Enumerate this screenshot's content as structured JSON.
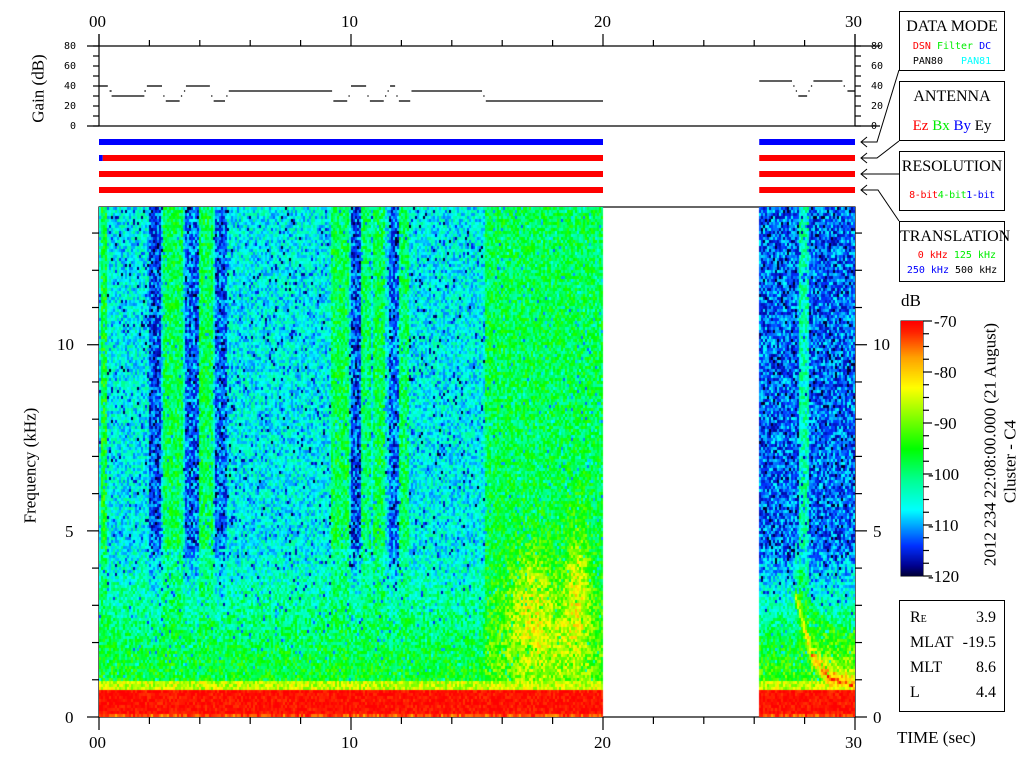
{
  "gain_panel": {
    "ylabel": "Gain (dB)",
    "yticks": [
      "0",
      "20",
      "40",
      "60",
      "80"
    ],
    "ylim": [
      0,
      80
    ]
  },
  "time_axis": {
    "ticks": [
      "00",
      "10",
      "20",
      "30"
    ],
    "xlim": [
      0,
      30
    ],
    "label": "TIME (sec)"
  },
  "spectrogram": {
    "ylabel": "Frequency (kHz)",
    "yticks": [
      "0",
      "5",
      "10"
    ],
    "ylim": [
      0,
      13.7
    ]
  },
  "legend": {
    "data_mode": {
      "title": "DATA MODE",
      "items": [
        {
          "label": "DSN",
          "color": "#ff0000"
        },
        {
          "label": "Filter",
          "color": "#00ee00"
        },
        {
          "label": "DC",
          "color": "#0000ff"
        },
        {
          "label": "PAN80",
          "color": "#000000"
        },
        {
          "label": "PAN81",
          "color": "#00ffff"
        }
      ]
    },
    "antenna": {
      "title": "ANTENNA",
      "items": [
        {
          "label": "Ez",
          "color": "#ff0000"
        },
        {
          "label": "Bx",
          "color": "#00ee00"
        },
        {
          "label": "By",
          "color": "#0000ff"
        },
        {
          "label": "Ey",
          "color": "#000000"
        }
      ]
    },
    "resolution": {
      "title": "RESOLUTION",
      "items": [
        {
          "label": "8-bit",
          "color": "#ff0000"
        },
        {
          "label": "4-bit",
          "color": "#00ee00"
        },
        {
          "label": "1-bit",
          "color": "#0000ff"
        }
      ]
    },
    "translation": {
      "title": "TRANSLATION",
      "items": [
        {
          "label": "0 kHz",
          "color": "#ff0000"
        },
        {
          "label": "125 kHz",
          "color": "#00ee00"
        },
        {
          "label": "250 kHz",
          "color": "#0000ff"
        },
        {
          "label": "500 kHz",
          "color": "#000000"
        }
      ]
    }
  },
  "colorbar": {
    "unit": "dB",
    "ticks": [
      "-70",
      "-80",
      "-90",
      "-100",
      "-110",
      "-120"
    ],
    "range": [
      -120,
      -70
    ]
  },
  "header_text": {
    "timestamp": "2012 234 22:08:00.000 (21 August)",
    "spacecraft": "Cluster - C4"
  },
  "info": {
    "rows": [
      {
        "key": "R",
        "sub": "E",
        "value": "3.9"
      },
      {
        "key": "MLAT",
        "sub": "",
        "value": "-19.5"
      },
      {
        "key": "MLT",
        "sub": "",
        "value": "8.6"
      },
      {
        "key": "L",
        "sub": "",
        "value": "4.4"
      }
    ]
  },
  "chart_data": [
    {
      "type": "line",
      "title": "Gain",
      "xlabel": "TIME (sec)",
      "ylabel": "Gain (dB)",
      "xlim": [
        0,
        30
      ],
      "ylim": [
        0,
        80
      ],
      "step_segments_sec_db": [
        [
          0,
          0.35,
          40
        ],
        [
          0.42,
          0.5,
          35
        ],
        [
          0.5,
          1.8,
          30
        ],
        [
          1.8,
          1.86,
          35
        ],
        [
          1.9,
          2.5,
          40
        ],
        [
          2.55,
          2.6,
          30
        ],
        [
          2.65,
          3.2,
          25
        ],
        [
          3.25,
          3.3,
          30
        ],
        [
          3.37,
          3.42,
          35
        ],
        [
          3.45,
          4.4,
          40
        ],
        [
          4.45,
          4.5,
          30
        ],
        [
          4.55,
          5.0,
          25
        ],
        [
          5.05,
          5.1,
          30
        ],
        [
          5.15,
          9.25,
          35
        ],
        [
          9.3,
          9.85,
          25
        ],
        [
          9.9,
          9.95,
          30
        ],
        [
          10.0,
          10.6,
          40
        ],
        [
          10.65,
          10.7,
          30
        ],
        [
          10.75,
          11.3,
          25
        ],
        [
          11.35,
          11.4,
          30
        ],
        [
          11.45,
          11.5,
          35
        ],
        [
          11.55,
          11.75,
          40
        ],
        [
          11.8,
          11.85,
          30
        ],
        [
          11.9,
          12.35,
          25
        ],
        [
          12.4,
          15.2,
          35
        ],
        [
          15.25,
          15.3,
          30
        ],
        [
          15.35,
          20.0,
          25
        ],
        [
          26.2,
          27.5,
          45
        ],
        [
          27.55,
          27.6,
          40
        ],
        [
          27.65,
          27.7,
          35
        ],
        [
          27.75,
          28.1,
          30
        ],
        [
          28.15,
          28.2,
          35
        ],
        [
          28.25,
          28.3,
          40
        ],
        [
          28.35,
          29.5,
          45
        ],
        [
          29.55,
          29.6,
          40
        ],
        [
          29.7,
          30.0,
          35
        ]
      ]
    },
    {
      "type": "bar",
      "title": "Instrument status rows",
      "rows": [
        {
          "legend": "data_mode",
          "segments": [
            [
              0,
              20,
              "#0000ff"
            ],
            [
              26.2,
              30,
              "#0000ff"
            ]
          ]
        },
        {
          "legend": "antenna",
          "segments": [
            [
              0,
              0.15,
              "#0000ff"
            ],
            [
              0.15,
              20,
              "#ff0000"
            ],
            [
              26.2,
              30,
              "#ff0000"
            ]
          ]
        },
        {
          "legend": "resolution",
          "segments": [
            [
              0,
              20,
              "#ff0000"
            ],
            [
              26.2,
              30,
              "#ff0000"
            ]
          ]
        },
        {
          "legend": "translation",
          "segments": [
            [
              0,
              20,
              "#ff0000"
            ],
            [
              26.2,
              30,
              "#ff0000"
            ]
          ]
        }
      ]
    },
    {
      "type": "heatmap",
      "title": "Spectrogram",
      "xlabel": "TIME (sec)",
      "ylabel": "Frequency (kHz)",
      "xlim": [
        0,
        30
      ],
      "ylim": [
        0,
        13.7
      ],
      "zlim_db": [
        -120,
        -70
      ],
      "data_intervals_sec": [
        [
          0,
          20
        ],
        [
          26.2,
          30
        ]
      ],
      "background_db": [
        {
          "t0": 0,
          "t1": 15.3,
          "db": -106
        },
        {
          "t0": 15.3,
          "t1": 20,
          "db": -98
        },
        {
          "t0": 26.2,
          "t1": 30,
          "db": -112
        }
      ],
      "low_band_db": {
        "f0_khz": 0,
        "f1_khz": 0.75,
        "db": -71
      },
      "enhanced_band": [
        {
          "t0": 0,
          "t1": 15.3,
          "knee_khz": 4.5,
          "db": -96
        },
        {
          "t0": 15.3,
          "t1": 20,
          "knee_khz": 5,
          "db": -92
        },
        {
          "t0": 26.2,
          "t1": 30,
          "knee_khz": 4.6,
          "db": -93
        }
      ],
      "stripes": [
        {
          "t0": 0.05,
          "t1": 0.3,
          "offset_db": 10
        },
        {
          "t0": 1.95,
          "t1": 2.45,
          "offset_db": -7
        },
        {
          "t0": 2.55,
          "t1": 3.35,
          "offset_db": 8
        },
        {
          "t0": 3.4,
          "t1": 4.0,
          "offset_db": -6
        },
        {
          "t0": 4.0,
          "t1": 4.5,
          "offset_db": 8
        },
        {
          "t0": 4.6,
          "t1": 5.1,
          "offset_db": -6
        },
        {
          "t0": 9.2,
          "t1": 9.95,
          "offset_db": 8
        },
        {
          "t0": 10.0,
          "t1": 10.4,
          "offset_db": -7
        },
        {
          "t0": 10.4,
          "t1": 10.8,
          "offset_db": 7
        },
        {
          "t0": 10.9,
          "t1": 11.35,
          "offset_db": 8
        },
        {
          "t0": 11.5,
          "t1": 11.9,
          "offset_db": -6
        },
        {
          "t0": 11.9,
          "t1": 12.3,
          "offset_db": 7
        },
        {
          "t0": 27.75,
          "t1": 28.2,
          "offset_db": 9
        }
      ],
      "hotspots": [
        {
          "t": 17.2,
          "f": 3.3,
          "dt": 0.7,
          "df": 1.1,
          "db": 9
        },
        {
          "t": 19.0,
          "f": 3.6,
          "dt": 0.35,
          "df": 1.3,
          "db": 11
        },
        {
          "t": 17.8,
          "f": 2.0,
          "dt": 1.2,
          "df": 0.8,
          "db": 5
        }
      ],
      "falling_tone_khz": [
        [
          27.6,
          3.3
        ],
        [
          28.3,
          1.6
        ],
        [
          29.0,
          1.0
        ],
        [
          30.0,
          0.8
        ]
      ]
    }
  ]
}
